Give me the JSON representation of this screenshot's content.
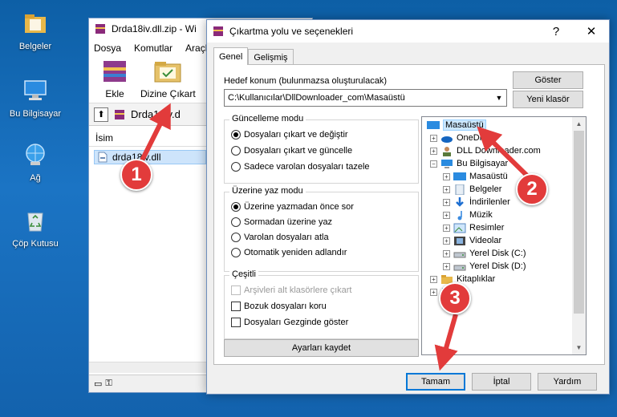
{
  "desktop": {
    "icons": [
      {
        "label": "Belgeler",
        "icon": "folder-icon"
      },
      {
        "label": "Bu Bilgisayar",
        "icon": "computer-icon"
      },
      {
        "label": "Ağ",
        "icon": "network-icon"
      },
      {
        "label": "Çöp Kutusu",
        "icon": "recycle-bin-icon"
      }
    ]
  },
  "winrar": {
    "title": "Drda18iv.dll.zip - Wi",
    "menu": [
      "Dosya",
      "Komutlar",
      "Araçla"
    ],
    "tools": [
      {
        "label": "Ekle"
      },
      {
        "label": "Dizine Çıkart"
      }
    ],
    "path": "Drda18iv.d",
    "column_name": "İsim",
    "file": "drda18iv.dll"
  },
  "dialog": {
    "title": "Çıkartma yolu ve seçenekleri",
    "help_btn": "?",
    "close_btn": "✕",
    "tabs": [
      "Genel",
      "Gelişmiş"
    ],
    "dest_label": "Hedef konum (bulunmazsa oluşturulacak)",
    "dest_value": "C:\\Kullanıcılar\\DllDownloader_com\\Masaüstü",
    "show_btn": "Göster",
    "new_folder_btn": "Yeni klasör",
    "update_group": {
      "title": "Güncelleme modu",
      "options": [
        "Dosyaları çıkart ve değiştir",
        "Dosyaları çıkart ve güncelle",
        "Sadece varolan dosyaları tazele"
      ],
      "selected": 0
    },
    "overwrite_group": {
      "title": "Üzerine yaz modu",
      "options": [
        "Üzerine yazmadan önce sor",
        "Sormadan üzerine yaz",
        "Varolan dosyaları atla",
        "Otomatik yeniden adlandır"
      ],
      "selected": 0
    },
    "misc_group": {
      "title": "Çeşitli",
      "options": [
        "Arşivleri alt klasörlere çıkart",
        "Bozuk dosyaları koru",
        "Dosyaları Gezginde göster"
      ]
    },
    "save_settings_btn": "Ayarları kaydet",
    "tree": [
      {
        "label": "Masaüstü",
        "level": 0,
        "icon": "desktop-icon",
        "selected": true
      },
      {
        "label": "OneDrive",
        "level": 1,
        "icon": "cloud-icon",
        "expander": "+"
      },
      {
        "label": "DLL Downloader.com",
        "level": 1,
        "icon": "user-icon",
        "expander": "+"
      },
      {
        "label": "Bu Bilgisayar",
        "level": 1,
        "icon": "computer-icon",
        "expander": "−"
      },
      {
        "label": "Masaüstü",
        "level": 2,
        "icon": "desktop-icon",
        "expander": "+"
      },
      {
        "label": "Belgeler",
        "level": 2,
        "icon": "documents-icon",
        "expander": "+"
      },
      {
        "label": "İndirilenler",
        "level": 2,
        "icon": "download-icon",
        "expander": "+"
      },
      {
        "label": "Müzik",
        "level": 2,
        "icon": "music-icon",
        "expander": "+"
      },
      {
        "label": "Resimler",
        "level": 2,
        "icon": "pictures-icon",
        "expander": "+"
      },
      {
        "label": "Videolar",
        "level": 2,
        "icon": "video-icon",
        "expander": "+"
      },
      {
        "label": "Yerel Disk (C:)",
        "level": 2,
        "icon": "drive-icon",
        "expander": "+"
      },
      {
        "label": "Yerel Disk (D:)",
        "level": 2,
        "icon": "drive-icon",
        "expander": "+"
      },
      {
        "label": "Kitaplıklar",
        "level": 1,
        "icon": "library-icon",
        "expander": "+"
      },
      {
        "label": "",
        "level": 1,
        "icon": "network-icon",
        "expander": "+"
      }
    ],
    "ok_btn": "Tamam",
    "cancel_btn": "İptal",
    "help_text_btn": "Yardım"
  },
  "annotations": [
    "1",
    "2",
    "3"
  ],
  "colors": {
    "annotation": "#e23b3b",
    "selection": "#cce8ff",
    "desktop": "#1b74c4"
  }
}
